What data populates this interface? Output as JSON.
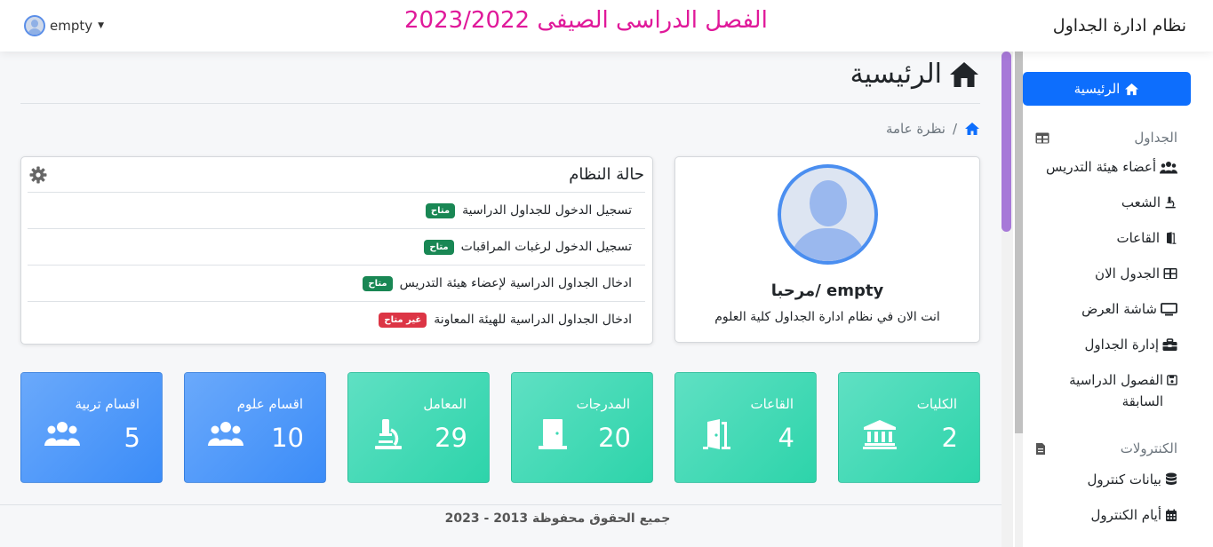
{
  "navbar": {
    "brand": "نظام ادارة الجداول",
    "term_title": "الفصل الدراسى الصيفى 2023/2022",
    "user_name": "empty"
  },
  "sidebar": {
    "home": "الرئيسية",
    "section_tables": "الجداول",
    "tables_items": [
      {
        "label": "أعضاء هيئة التدريس",
        "icon": "users-icon"
      },
      {
        "label": "الشعب",
        "icon": "microscope-icon"
      },
      {
        "label": "القاعات",
        "icon": "door-open-icon"
      },
      {
        "label": "الجدول الان",
        "icon": "table-icon"
      },
      {
        "label": "شاشة العرض",
        "icon": "monitor-icon"
      },
      {
        "label": "إدارة الجداول",
        "icon": "toolbox-icon"
      },
      {
        "label": "الفصول الدراسية السابقة",
        "icon": "save-icon"
      }
    ],
    "section_controls": "الكنترولات",
    "controls_items": [
      {
        "label": "بيانات كنترول",
        "icon": "database-icon"
      },
      {
        "label": "أيام الكنترول",
        "icon": "calendar-icon"
      }
    ]
  },
  "page": {
    "title": "الرئيسية",
    "breadcrumb": "نظرة عامة"
  },
  "welcome": {
    "greeting": "مرحبا/ empty",
    "message": "انت الان في نظام ادارة الجداول كلية العلوم"
  },
  "system_status": {
    "title": "حالة النظام",
    "rows": [
      {
        "label": "تسجيل الدخول للجداول الدراسية",
        "status": "متاح",
        "ok": true
      },
      {
        "label": "تسجيل الدخول لرغبات المراقبات",
        "status": "متاح",
        "ok": true
      },
      {
        "label": "ادخال الجداول الدراسية لإعضاء هيئة التدريس",
        "status": "متاح",
        "ok": true
      },
      {
        "label": "ادخال الجداول الدراسية للهيئة المعاونة",
        "status": "غير متاح",
        "ok": false
      }
    ]
  },
  "stats": [
    {
      "label": "الكليات",
      "value": "2",
      "icon": "university-icon",
      "color": "green"
    },
    {
      "label": "القاعات",
      "value": "4",
      "icon": "door-open-icon",
      "color": "green"
    },
    {
      "label": "المدرجات",
      "value": "20",
      "icon": "door-closed-icon",
      "color": "green"
    },
    {
      "label": "المعامل",
      "value": "29",
      "icon": "microscope-icon",
      "color": "green"
    },
    {
      "label": "اقسام علوم",
      "value": "10",
      "icon": "users-icon",
      "color": "blue"
    },
    {
      "label": "اقسام تربية",
      "value": "5",
      "icon": "users-icon",
      "color": "blue"
    }
  ],
  "colors": {
    "primary": "#0d6efd",
    "term_title": "#e0199a",
    "success": "#198754",
    "danger": "#dc3545",
    "stat_green": "#3dd9b4",
    "stat_blue": "#4f97f9",
    "scroll_thumb": "#a779d8"
  },
  "footer": {
    "copyright": "جميع الحقوق محفوظة 2013 - 2023"
  }
}
